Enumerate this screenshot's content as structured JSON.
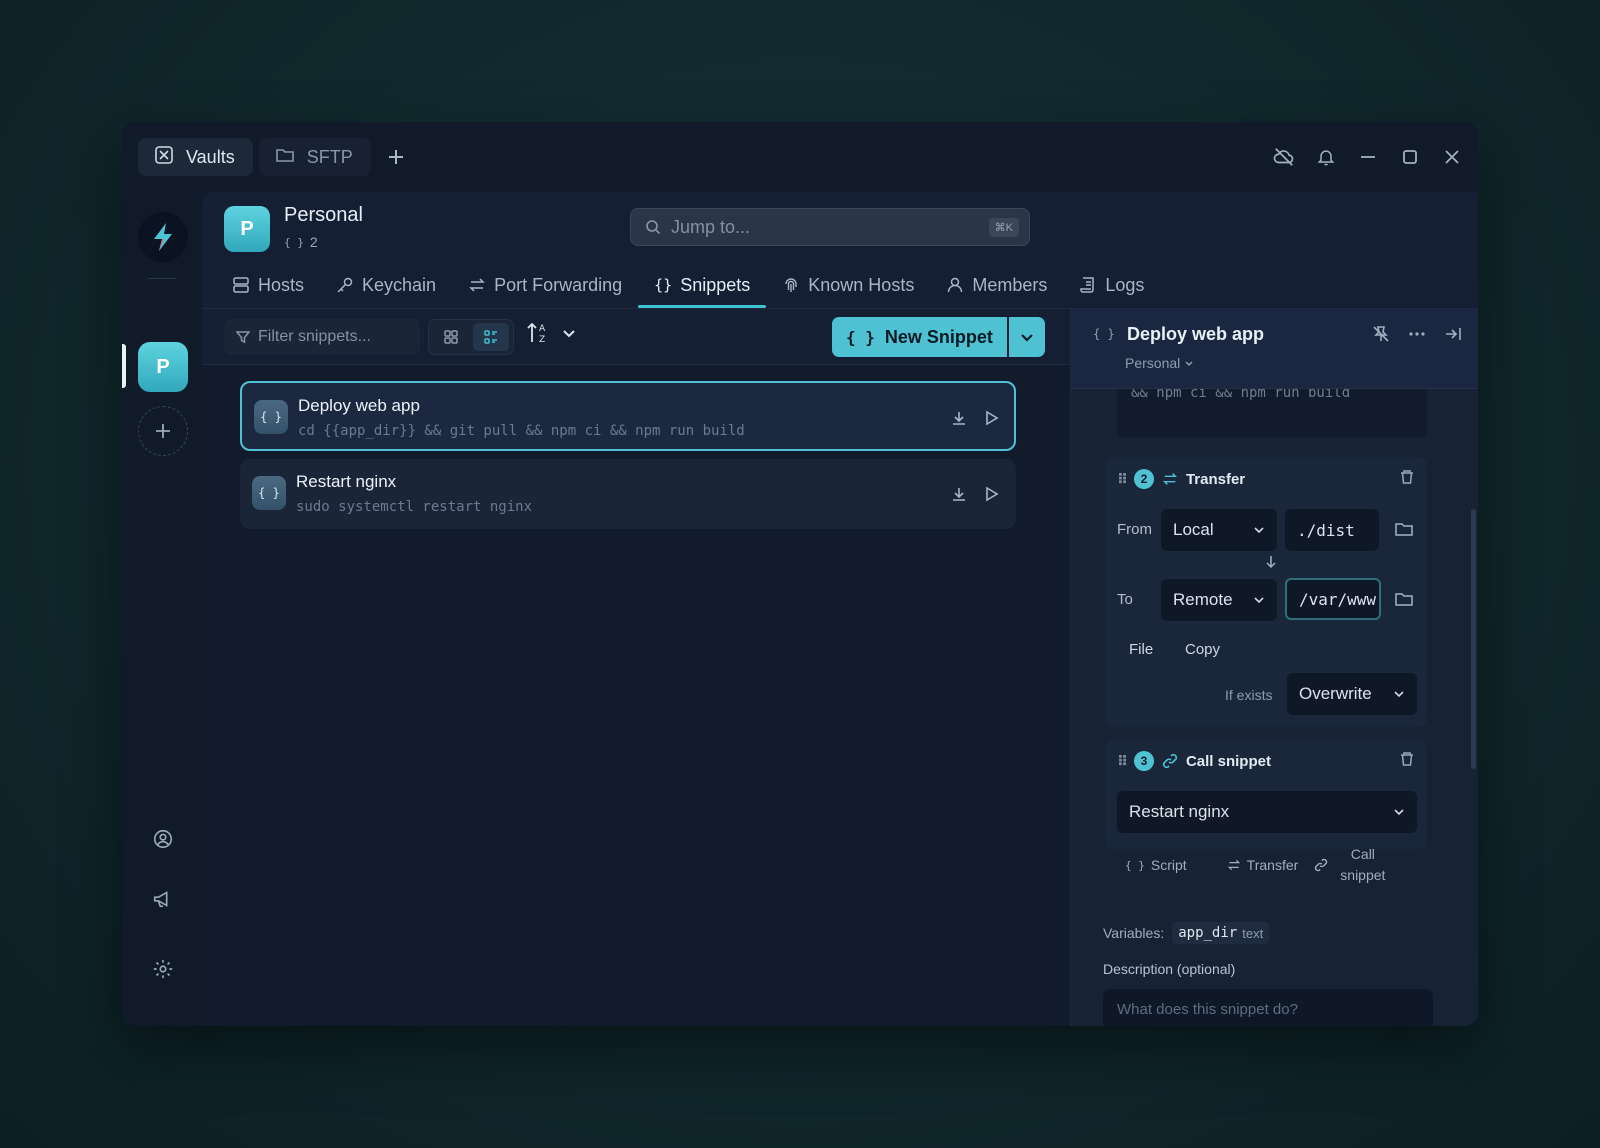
{
  "window_tabs": [
    {
      "label": "Vaults",
      "icon": "vault-icon"
    },
    {
      "label": "SFTP",
      "icon": "folder-icon"
    }
  ],
  "vault": {
    "initial": "P",
    "name": "Personal",
    "snippet_count": "2"
  },
  "search": {
    "placeholder": "Jump to...",
    "shortcut": "⌘K"
  },
  "nav_tabs": [
    {
      "label": "Hosts"
    },
    {
      "label": "Keychain"
    },
    {
      "label": "Port Forwarding"
    },
    {
      "label": "Snippets"
    },
    {
      "label": "Known Hosts"
    },
    {
      "label": "Members"
    },
    {
      "label": "Logs"
    }
  ],
  "active_nav": "Snippets",
  "toolbar": {
    "filter_placeholder": "Filter snippets...",
    "new_label": "New Snippet"
  },
  "snippets": [
    {
      "title": "Deploy web app",
      "command": "cd {{app_dir}} && git pull && npm ci && npm run build",
      "selected": true
    },
    {
      "title": "Restart nginx",
      "command": "sudo systemctl restart nginx",
      "selected": false
    }
  ],
  "detail": {
    "title": "Deploy web app",
    "vault": "Personal",
    "script_tail": "&& npm ci && npm run build",
    "transfer": {
      "num": "2",
      "title": "Transfer",
      "from_label": "From",
      "from_source": "Local",
      "from_path": "./dist",
      "to_label": "To",
      "to_source": "Remote",
      "to_path": "/var/www",
      "kind_file": "File",
      "kind_copy": "Copy",
      "if_exists_label": "If exists",
      "if_exists_value": "Overwrite"
    },
    "call": {
      "num": "3",
      "title": "Call snippet",
      "target": "Restart nginx"
    },
    "add_links": {
      "script": "Script",
      "transfer": "Transfer",
      "call_line1": "Call",
      "call_line2": "snippet"
    },
    "variables_label": "Variables:",
    "variable": {
      "name": "app_dir",
      "type": "text"
    },
    "description_label": "Description (optional)",
    "description_placeholder": "What does this snippet do?"
  },
  "colors": {
    "accent": "#4ec2d3",
    "background": "#111a2a"
  }
}
